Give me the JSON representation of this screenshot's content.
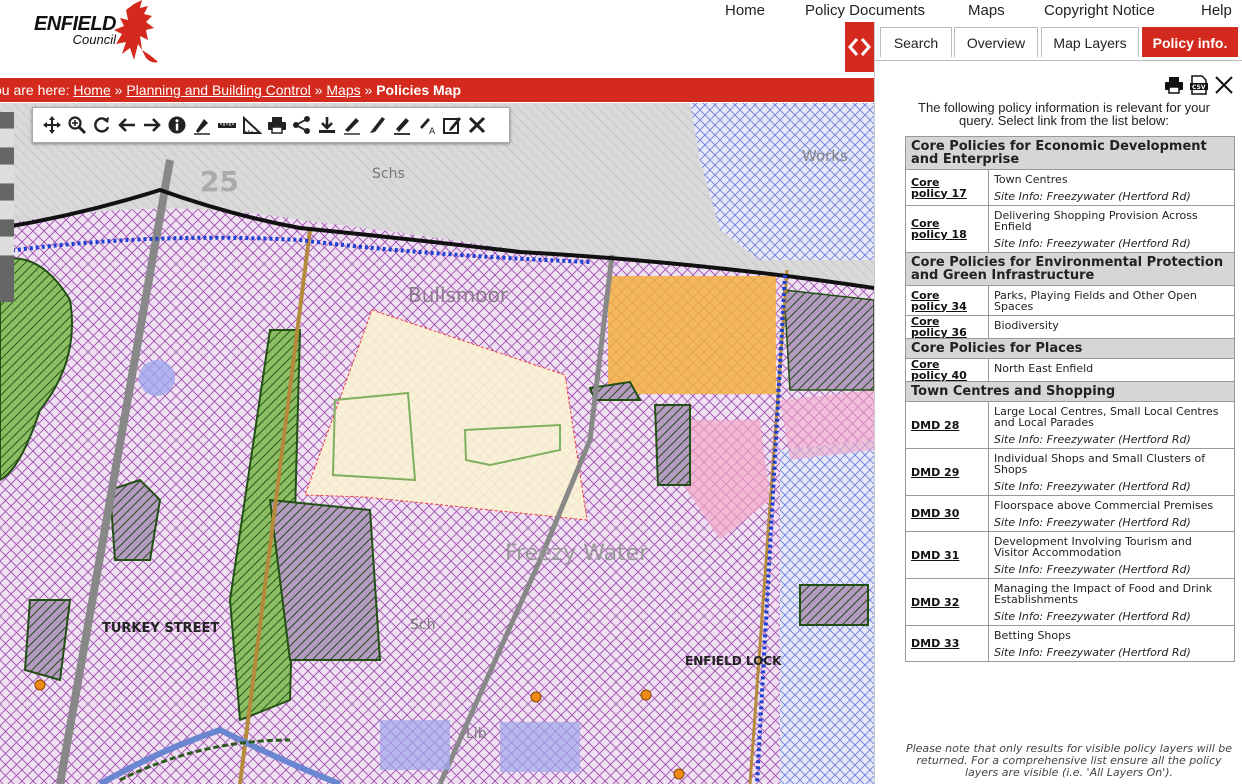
{
  "header": {
    "logo_name": "ENFIELD",
    "logo_sub": "Council",
    "nav": [
      "Home",
      "Policy Documents",
      "Maps",
      "Copyright Notice",
      "Help"
    ]
  },
  "breadcrumb": {
    "prefix": "ou are here:",
    "items": [
      "Home",
      "Planning and Building Control",
      "Maps"
    ],
    "current": "Policies Map",
    "separator": "»"
  },
  "map": {
    "labels": {
      "number": "25",
      "schs": "Schs",
      "works": "Works",
      "bullsmoor": "Bullsmoor",
      "freezywater": "Freezy Water",
      "turkey_street": "TURKEY STREET",
      "enfield_lock": "ENFIELD LOCK",
      "sch": "Sch",
      "lib": "Lib"
    },
    "toolbar": [
      "pan-icon",
      "zoom-icon",
      "refresh-icon",
      "back-icon",
      "forward-icon",
      "info-icon",
      "measure-point-icon",
      "measure-line-icon",
      "measure-area-icon",
      "print-icon",
      "share-icon",
      "download-icon",
      "draw-line-icon",
      "draw-pen-icon",
      "draw-marker-icon",
      "draw-text-icon",
      "edit-icon",
      "close-icon"
    ]
  },
  "panel": {
    "tabs": [
      "Search",
      "Overview",
      "Map Layers",
      "Policy info."
    ],
    "active_tab": "Policy info.",
    "intro": "The following policy information is relevant for your query. Select link from the list below:",
    "sections": [
      {
        "title": "Core Policies for Economic Development and Enterprise",
        "rows": [
          {
            "ref": "Core policy 17",
            "title": "Town Centres",
            "site": "Site Info: Freezywater (Hertford Rd)"
          },
          {
            "ref": "Core policy 18",
            "title": "Delivering Shopping Provision Across Enfield",
            "site": "Site Info: Freezywater (Hertford Rd)"
          }
        ]
      },
      {
        "title": "Core Policies for Environmental Protection and Green Infrastructure",
        "rows": [
          {
            "ref": "Core policy 34",
            "title": "Parks, Playing Fields and Other Open Spaces",
            "site": ""
          },
          {
            "ref": "Core policy 36",
            "title": "Biodiversity",
            "site": ""
          }
        ]
      },
      {
        "title": "Core Policies for Places",
        "rows": [
          {
            "ref": "Core policy 40",
            "title": "North East Enfield",
            "site": ""
          }
        ]
      },
      {
        "title": "Town Centres and Shopping",
        "rows": [
          {
            "ref": "DMD 28",
            "title": "Large Local Centres, Small Local Centres and Local Parades",
            "site": "Site Info: Freezywater (Hertford Rd)"
          },
          {
            "ref": "DMD 29",
            "title": "Individual Shops and Small Clusters of Shops",
            "site": "Site Info: Freezywater (Hertford Rd)"
          },
          {
            "ref": "DMD 30",
            "title": "Floorspace above Commercial Premises",
            "site": "Site Info: Freezywater (Hertford Rd)"
          },
          {
            "ref": "DMD 31",
            "title": "Development Involving Tourism and Visitor Accommodation",
            "site": "Site Info: Freezywater (Hertford Rd)"
          },
          {
            "ref": "DMD 32",
            "title": "Managing the Impact of Food and Drink Establishments",
            "site": "Site Info: Freezywater (Hertford Rd)"
          },
          {
            "ref": "DMD 33",
            "title": "Betting Shops",
            "site": "Site Info: Freezywater (Hertford Rd)"
          }
        ]
      }
    ],
    "footnote": "Please note that only results for visible policy layers will be returned. For a comprehensive list ensure all the policy layers are visible (i.e. 'All Layers On')."
  },
  "colors": {
    "brand_red": "#d42a1e",
    "section_grey": "#d6d6d6",
    "hatch_purple": "#a050b0",
    "green_belt": "#2f6a22",
    "orange_zone": "#f4b042",
    "blue_dots": "#1f3fd0"
  }
}
